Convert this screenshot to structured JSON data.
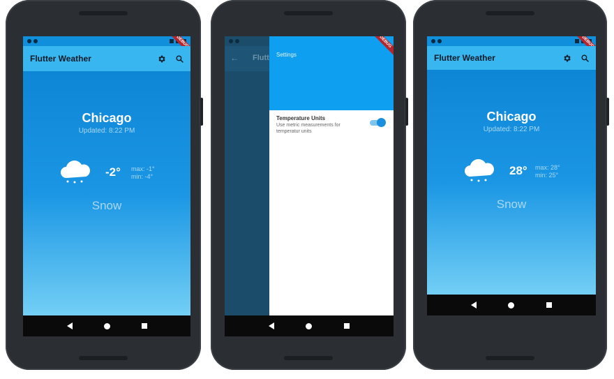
{
  "phones": [
    {
      "screen": "weather",
      "app_title": "Flutter Weather",
      "city": "Chicago",
      "updated": "Updated: 8:22 PM",
      "temperature": "-2°",
      "max": "max: -1°",
      "min": "min: -4°",
      "condition": "Snow",
      "icons": [
        "gear-icon",
        "search-icon",
        "cloud-snow-icon"
      ]
    },
    {
      "screen": "settings",
      "behind_title": "Flutt",
      "drawer_title": "Settings",
      "setting_title": "Temperature Units",
      "setting_subtitle": "Use metric measurements for temperatur units",
      "toggle_on": true
    },
    {
      "screen": "weather",
      "app_title": "Flutter Weather",
      "city": "Chicago",
      "updated": "Updated: 8:22 PM",
      "temperature": "28°",
      "max": "max: 28°",
      "min": "min: 25°",
      "condition": "Snow",
      "icons": [
        "gear-icon",
        "search-icon",
        "cloud-snow-icon"
      ]
    }
  ],
  "debug_label": "DEBUG",
  "colors": {
    "appbar": "#38b6f0",
    "body_top": "#0e86d6",
    "body_bottom": "#73cff5",
    "drawer_header": "#0e9ff0",
    "toggle": "#1a8fe0"
  }
}
